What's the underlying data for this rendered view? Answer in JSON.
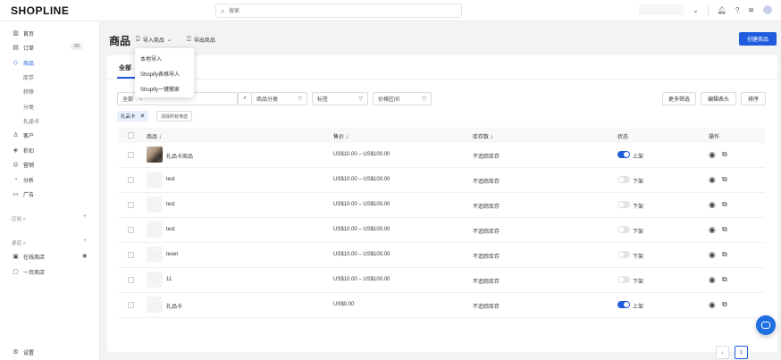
{
  "brand": {
    "logo": "SHOPLINE",
    "accent": "#1e5cdc"
  },
  "topbar": {
    "search_placeholder": "搜索",
    "icons": [
      "chevron-down-icon",
      "bell-icon",
      "help-icon",
      "wifi-icon",
      "user-icon"
    ]
  },
  "sidebar": {
    "items": [
      {
        "label": "首页",
        "icon": "home-icon"
      },
      {
        "label": "订单",
        "icon": "order-icon",
        "badge": "20"
      },
      {
        "label": "商品",
        "icon": "product-icon"
      },
      {
        "label": "客户",
        "icon": "customer-icon"
      },
      {
        "label": "折扣",
        "icon": "discount-icon"
      },
      {
        "label": "营销",
        "icon": "marketing-icon"
      },
      {
        "label": "分析",
        "icon": "analytics-icon"
      },
      {
        "label": "广告",
        "icon": "ads-icon"
      }
    ],
    "sub_items": [
      "库存",
      "转移",
      "分类",
      "礼品卡"
    ],
    "section_apps": "应用 >",
    "section_channels": "渠道 >",
    "channels": [
      {
        "label": "在线商店",
        "icon": "store-icon"
      },
      {
        "label": "一页商店",
        "icon": "page-store-icon"
      }
    ],
    "settings": "设置"
  },
  "header": {
    "title": "商品",
    "import_label": "导入商品",
    "export_label": "导出商品",
    "create_label": "创建商品"
  },
  "import_menu": [
    "本地导入",
    "Shopify表格导入",
    "Shopify一键搬家"
  ],
  "tabs": {
    "all": "全部"
  },
  "filters": {
    "scope_label": "全部",
    "category": "商品分类",
    "tag": "标签",
    "price_range": "价格区间",
    "more": "更多筛选",
    "edit_columns": "编辑表头",
    "sort": "排序",
    "active_tag": "礼品卡",
    "clear": "清除所有筛选"
  },
  "table": {
    "headers": {
      "product": "商品 ↕",
      "price": "售价 ↕",
      "stock": "库存数 ↕",
      "status": "状态",
      "actions": "操作"
    },
    "rows": [
      {
        "name": "礼品卡商品",
        "price": "US$10.00 – US$100.00",
        "stock": "不追踪库存",
        "on": true,
        "status": "上架",
        "photo": true
      },
      {
        "name": "test",
        "price": "US$10.00 – US$100.00",
        "stock": "不追踪库存",
        "on": false,
        "status": "下架",
        "photo": false
      },
      {
        "name": "test",
        "price": "US$10.00 – US$100.00",
        "stock": "不追踪库存",
        "on": false,
        "status": "下架",
        "photo": false
      },
      {
        "name": "test",
        "price": "US$10.00 – US$100.00",
        "stock": "不追踪库存",
        "on": false,
        "status": "下架",
        "photo": false
      },
      {
        "name": "teset",
        "price": "US$10.00 – US$100.00",
        "stock": "不追踪库存",
        "on": false,
        "status": "下架",
        "photo": false
      },
      {
        "name": "11",
        "price": "US$10.00 – US$100.00",
        "stock": "不追踪库存",
        "on": false,
        "status": "下架",
        "photo": false
      },
      {
        "name": "礼品卡",
        "price": "US$0.00",
        "stock": "不追踪库存",
        "on": true,
        "status": "上架",
        "photo": false
      }
    ]
  },
  "pagination": {
    "current": "1"
  }
}
